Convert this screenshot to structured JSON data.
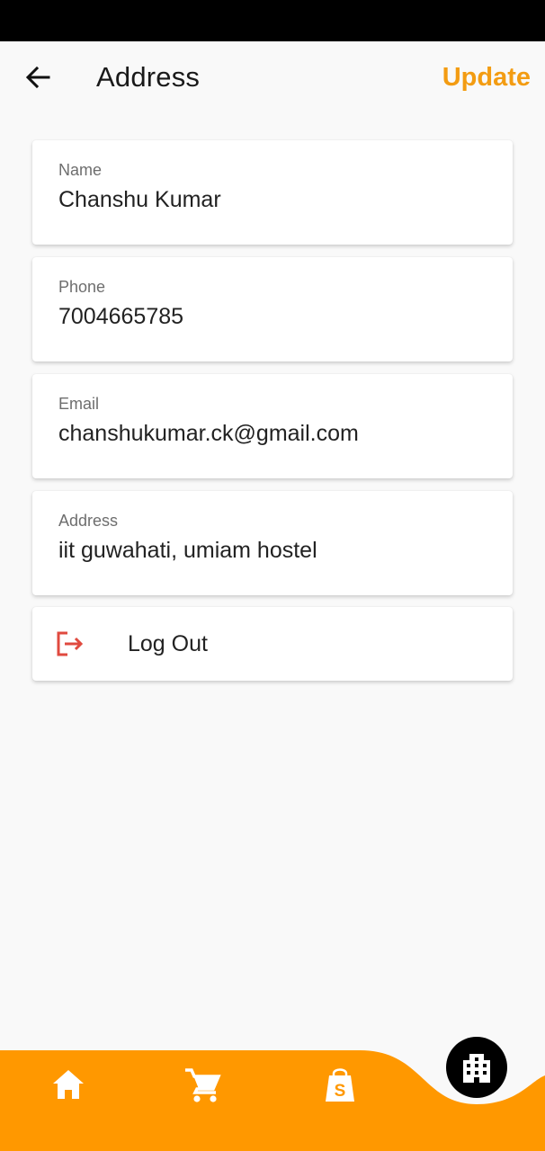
{
  "app_bar": {
    "title": "Address",
    "update_label": "Update",
    "back_icon": "arrow-back-icon"
  },
  "fields": [
    {
      "label": "Name",
      "value": "Chanshu Kumar"
    },
    {
      "label": "Phone",
      "value": "7004665785"
    },
    {
      "label": "Email",
      "value": "chanshukumar.ck@gmail.com"
    },
    {
      "label": "Address",
      "value": "iit guwahati, umiam hostel"
    }
  ],
  "logout": {
    "label": "Log Out",
    "icon": "logout-icon"
  },
  "bottom_nav": {
    "items": [
      "home-icon",
      "cart-icon",
      "shopify-bag-icon"
    ],
    "active": "building-icon"
  },
  "colors": {
    "accent": "#f39c12",
    "nav_bar": "#ff9800",
    "logout_icon": "#e04a3f",
    "background": "#f9f9f9"
  }
}
